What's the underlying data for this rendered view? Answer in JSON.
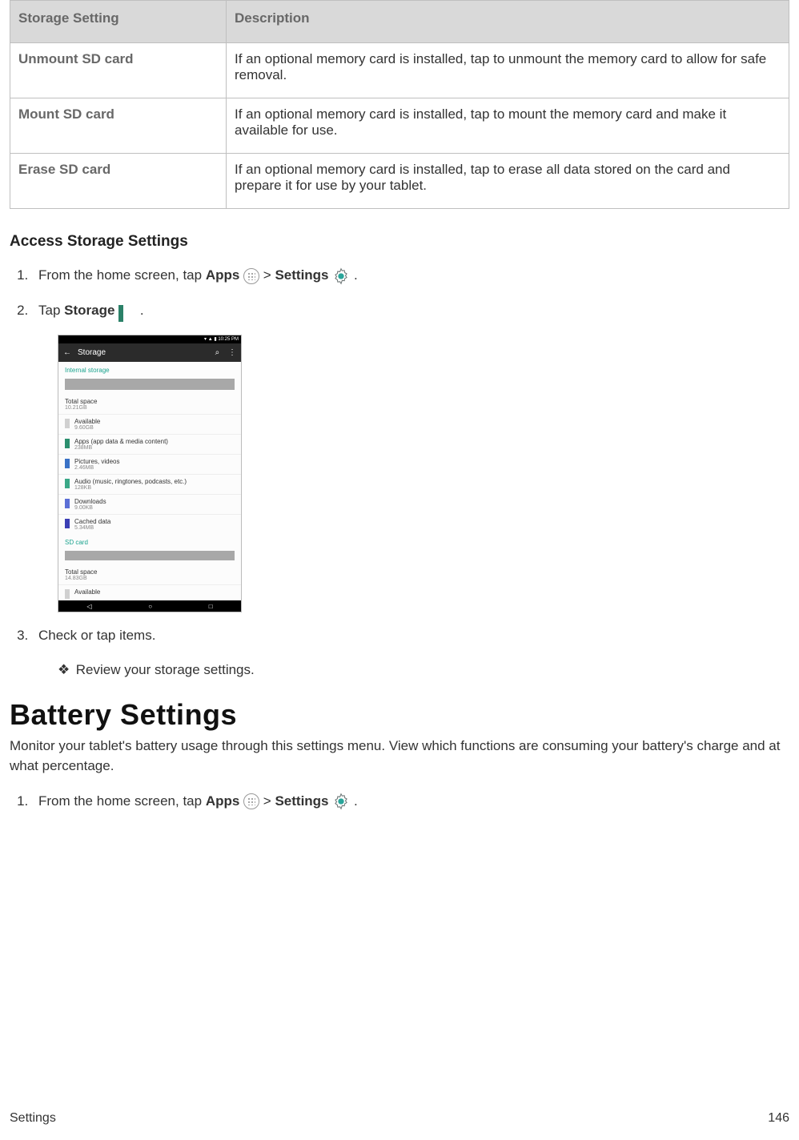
{
  "table": {
    "headers": [
      "Storage Setting",
      "Description"
    ],
    "rows": [
      {
        "name": "Unmount SD card",
        "desc": "If an optional memory card is installed, tap to unmount the memory card to allow for safe removal."
      },
      {
        "name": "Mount SD card",
        "desc": "If an optional memory card is installed, tap to mount the memory card and make it available for use."
      },
      {
        "name": "Erase SD card",
        "desc": "If an optional memory card is installed, tap to erase all data stored on the card and prepare it for use by your tablet."
      }
    ]
  },
  "section1": {
    "heading": "Access Storage Settings",
    "step1": {
      "a": "From the home screen, tap ",
      "apps": "Apps",
      "gt": " > ",
      "settings": "Settings",
      "dot": "."
    },
    "step2": {
      "a": "Tap ",
      "storage": "Storage",
      "dot": "."
    },
    "step3": "Check or tap items.",
    "bullet": "Review your storage settings."
  },
  "screenshot": {
    "status_time": "10:25 PM",
    "appbar_title": "Storage",
    "cat1": "Internal storage",
    "total_label": "Total space",
    "total_value": "10.21GB",
    "rows": [
      {
        "color": "#d0d0d0",
        "t": "Available",
        "s": "9.60GB"
      },
      {
        "color": "#2b8f6e",
        "t": "Apps (app data & media content)",
        "s": "238MB"
      },
      {
        "color": "#3a72c6",
        "t": "Pictures, videos",
        "s": "2.46MB"
      },
      {
        "color": "#3aa887",
        "t": "Audio (music, ringtones, podcasts, etc.)",
        "s": "128KB"
      },
      {
        "color": "#5b6fd6",
        "t": "Downloads",
        "s": "9.00KB"
      },
      {
        "color": "#3b3fb5",
        "t": "Cached data",
        "s": "5.34MB"
      }
    ],
    "cat2": "SD card",
    "sd_total_label": "Total space",
    "sd_total_value": "14.83GB",
    "sd_available": "Available"
  },
  "section2": {
    "heading": "Battery Settings",
    "lead": "Monitor your tablet's battery usage through this settings menu. View which functions are consuming your battery's charge and at what percentage.",
    "step1": {
      "a": "From the home screen, tap ",
      "apps": "Apps",
      "gt": " > ",
      "settings": "Settings",
      "dot": "."
    }
  },
  "footer": {
    "left": "Settings",
    "right": "146"
  }
}
